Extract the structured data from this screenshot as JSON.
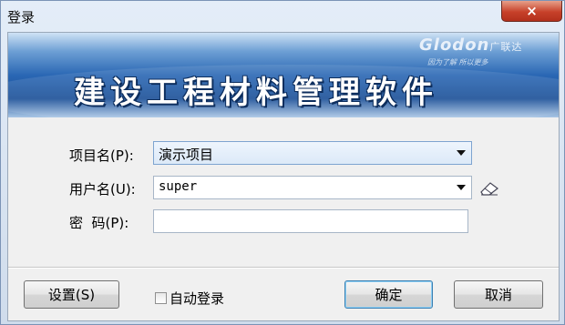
{
  "window": {
    "title": "登录",
    "close_label": "×"
  },
  "banner": {
    "brand": "Glodon",
    "brand_cn": "广联达",
    "slogan": "因为了解  所以更多",
    "title": "建设工程材料管理软件"
  },
  "form": {
    "project_label": "项目名(P):",
    "project_value": "演示项目",
    "user_label": "用户名(U):",
    "user_value": "super",
    "password_label": "密  码(P):",
    "password_value": ""
  },
  "footer": {
    "settings_label": "设置(S)",
    "auto_login_label": "自动登录",
    "auto_login_checked": false,
    "ok_label": "确定",
    "cancel_label": "取消"
  }
}
